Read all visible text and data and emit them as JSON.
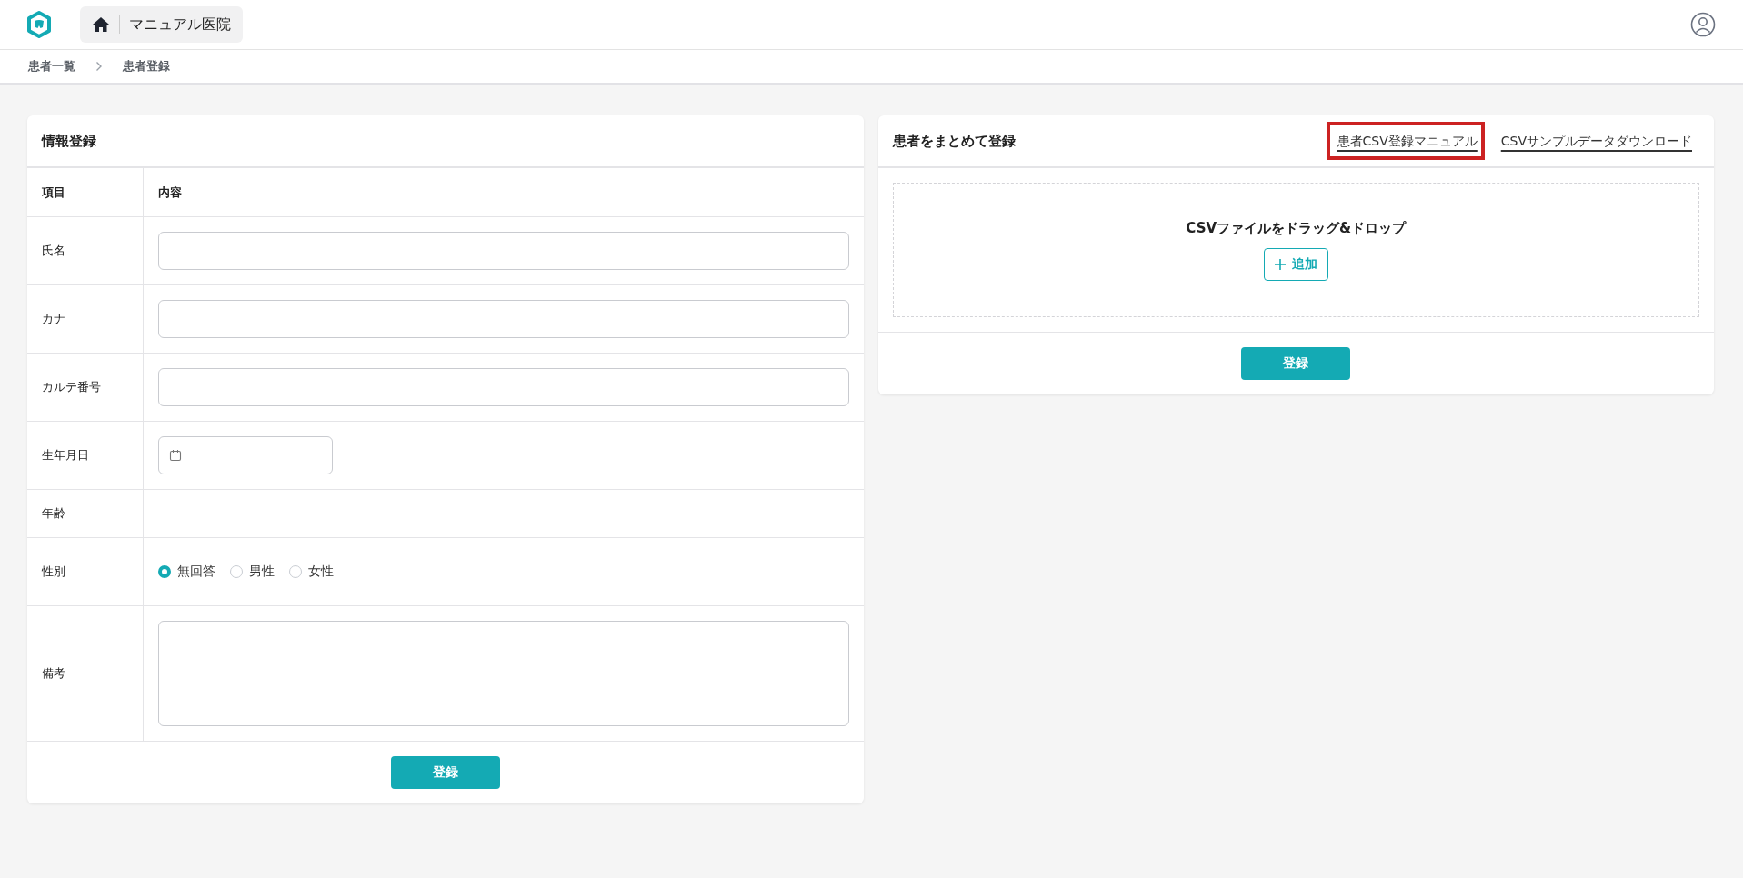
{
  "header": {
    "clinic_name": "マニュアル医院"
  },
  "breadcrumb": [
    {
      "label": "患者一覧"
    },
    {
      "label": "患者登録"
    }
  ],
  "info_form": {
    "title": "情報登録",
    "columns": [
      "項目",
      "内容"
    ],
    "rows": [
      {
        "label": "氏名",
        "kind": "text"
      },
      {
        "label": "カナ",
        "kind": "text"
      },
      {
        "label": "カルテ番号",
        "kind": "text"
      },
      {
        "label": "生年月日",
        "kind": "date"
      },
      {
        "label": "年齢",
        "kind": "empty"
      },
      {
        "label": "性別",
        "kind": "radio",
        "options": [
          {
            "label": "無回答",
            "selected": true
          },
          {
            "label": "男性",
            "selected": false
          },
          {
            "label": "女性",
            "selected": false
          }
        ]
      },
      {
        "label": "備考",
        "kind": "textarea"
      }
    ],
    "submit": "登録"
  },
  "bulk_form": {
    "title": "患者をまとめて登録",
    "links": [
      {
        "label": "患者CSV登録マニュアル",
        "highlighted": true
      },
      {
        "label": "CSVサンプルデータダウンロード",
        "highlighted": false
      }
    ],
    "dropzone_text": "CSVファイルをドラッグ&ドロップ",
    "add_button": "追加",
    "submit": "登録"
  }
}
